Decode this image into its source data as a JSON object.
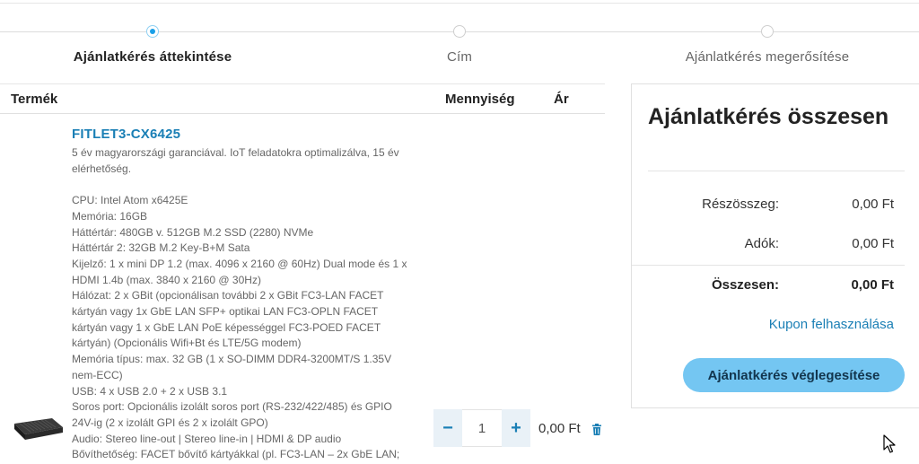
{
  "steps": [
    {
      "label": "Ajánlatkérés áttekintése",
      "active": true
    },
    {
      "label": "Cím",
      "active": false
    },
    {
      "label": "Ajánlatkérés megerősítése",
      "active": false
    }
  ],
  "cart": {
    "headers": {
      "product": "Termék",
      "quantity": "Mennyiség",
      "price": "Ár"
    },
    "item": {
      "title": "FITLET3-CX6425",
      "intro": [
        "5 év magyarországi garanciával. IoT feladatokra optimalizálva, 15 év",
        "elérhetőség."
      ],
      "specs": [
        "CPU: Intel Atom x6425E",
        "Memória: 16GB",
        "Háttértár: 480GB v. 512GB M.2 SSD (2280) NVMe",
        "Háttértár 2: 32GB M.2 Key-B+M Sata",
        "Kijelző: 1 x mini DP 1.2 (max. 4096 x 2160 @ 60Hz) Dual mode és 1 x",
        "HDMI 1.4b (max. 3840 x 2160 @ 30Hz)",
        "Hálózat: 2 x GBit (opcionálisan további 2 x GBit FC3-LAN FACET",
        "kártyán vagy 1x GbE LAN SFP+ optikai LAN FC3-OPLN FACET",
        "kártyán vagy 1 x GbE LAN PoE képességgel FC3-POED FACET",
        "kártyán) (Opcionális Wifi+Bt és LTE/5G modem)",
        "Memória típus: max. 32 GB (1 x SO-DIMM DDR4-3200MT/S 1.35V",
        "nem-ECC)",
        "USB: 4 x USB 2.0 + 2 x USB 3.1",
        "Soros port: Opcionális izolált soros port (RS-232/422/485) és GPIO",
        "24V-ig (2 x izolált GPI és 2 x izolált GPO)",
        "Audio: Stereo line-out | Stereo line-in | HDMI & DP audio",
        "Bővíthetőség: FACET bővítő kártyákkal (pl. FC3-LAN – 2x GbE LAN;"
      ],
      "qty_minus": "−",
      "qty_value": "1",
      "qty_plus": "+",
      "price": "0,00 Ft"
    }
  },
  "summary": {
    "title": "Ajánlatkérés összesen",
    "subtotal_label": "Részösszeg:",
    "subtotal_value": "0,00 Ft",
    "tax_label": "Adók:",
    "tax_value": "0,00 Ft",
    "total_label": "Összesen:",
    "total_value": "0,00 Ft",
    "coupon_link": "Kupon felhasználása",
    "submit_label": "Ajánlatkérés véglegesítése"
  },
  "colors": {
    "accent": "#1aa0e8",
    "link": "#1a7fb5",
    "button": "#74c6f2"
  }
}
